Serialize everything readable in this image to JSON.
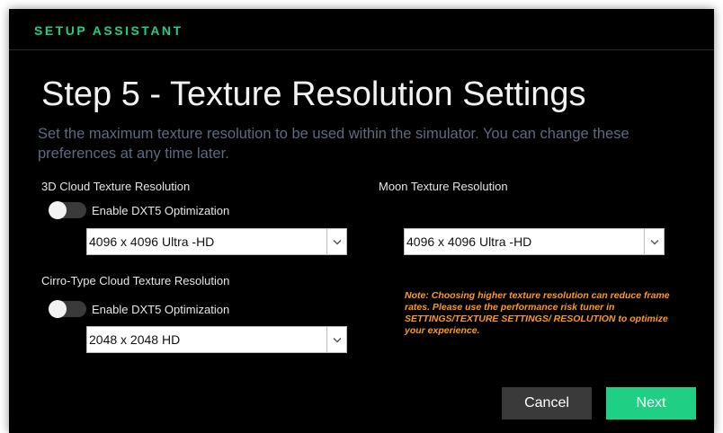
{
  "window": {
    "title": "SETUP ASSISTANT"
  },
  "page": {
    "heading": "Step 5 - Texture Resolution Settings",
    "subtitle": "Set the maximum texture resolution to be used within the simulator. You can change these preferences at any time later."
  },
  "cloud3d": {
    "label": "3D Cloud Texture Resolution",
    "toggle_label": "Enable DXT5 Optimization",
    "toggle_on": false,
    "selected": "4096 x 4096 Ultra -HD"
  },
  "moon": {
    "label": "Moon Texture Resolution",
    "selected": "4096 x 4096 Ultra -HD"
  },
  "cirro": {
    "label": "Cirro-Type Cloud Texture Resolution",
    "toggle_label": "Enable DXT5 Optimization",
    "toggle_on": false,
    "selected": "2048 x 2048 HD"
  },
  "note": {
    "text": "Note: Choosing higher texture resolution can reduce frame rates. Please use the performance risk tuner in SETTINGS/TEXTURE SETTINGS/ RESOLUTION to optimize your experience.",
    "color": "#ff9a1f"
  },
  "buttons": {
    "cancel": "Cancel",
    "next": "Next"
  },
  "colors": {
    "accent": "#1ecf86",
    "background": "#000000",
    "cancel_bg": "#3a3a3a"
  },
  "icons": {
    "dropdown": "chevron-down-icon"
  }
}
